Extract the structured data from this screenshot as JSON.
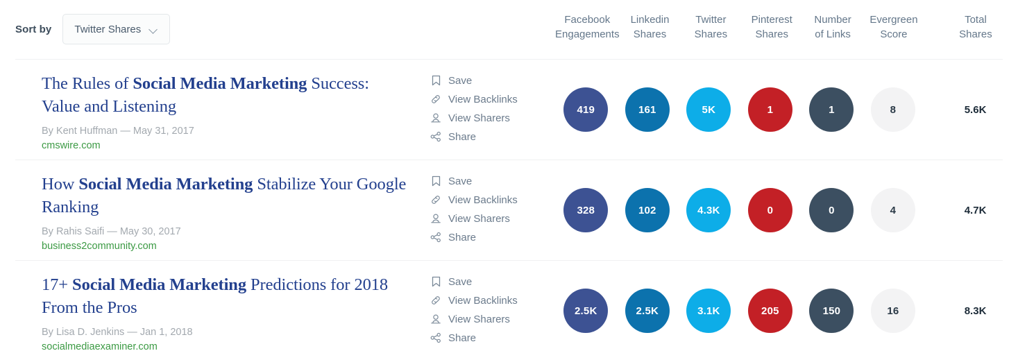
{
  "toolbar": {
    "sort_label": "Sort by",
    "sort_value": "Twitter Shares",
    "chevron_icon": "chevron-down-icon"
  },
  "columns": [
    {
      "line1": "Facebook",
      "line2": "Engagements",
      "sorted": false,
      "color": "#3d5293"
    },
    {
      "line1": "Linkedin",
      "line2": "Shares",
      "sorted": false,
      "color": "#0c72ad"
    },
    {
      "line1": "Twitter",
      "line2": "Shares",
      "sorted": true,
      "sort_arrow": "↓",
      "color": "#0dade8"
    },
    {
      "line1": "Pinterest",
      "line2": "Shares",
      "sorted": false,
      "color": "#c32026"
    },
    {
      "line1": "Number",
      "line2": "of Links",
      "sorted": false,
      "color": "#3c4f61"
    },
    {
      "line1": "Evergreen",
      "line2": "Score",
      "sorted": false,
      "color": "#f3f3f4"
    }
  ],
  "total_column": {
    "line1": "Total",
    "line2": "Shares"
  },
  "actions": [
    {
      "label": "Save",
      "icon": "bookmark-icon"
    },
    {
      "label": "View Backlinks",
      "icon": "link-icon"
    },
    {
      "label": "View Sharers",
      "icon": "person-icon"
    },
    {
      "label": "Share",
      "icon": "share-nodes-icon"
    }
  ],
  "rows": [
    {
      "title_parts": [
        {
          "text": "The Rules of ",
          "bold": false
        },
        {
          "text": "Social Media Marketing",
          "bold": true
        },
        {
          "text": " Success: Value and Listening",
          "bold": false
        }
      ],
      "byline": "By Kent Huffman — May 31, 2017",
      "domain": "cmswire.com",
      "metrics": [
        "419",
        "161",
        "5K",
        "1",
        "1",
        "8"
      ],
      "total": "5.6K"
    },
    {
      "title_parts": [
        {
          "text": "How ",
          "bold": false
        },
        {
          "text": "Social Media Marketing",
          "bold": true
        },
        {
          "text": " Stabilize Your Google Ranking",
          "bold": false
        }
      ],
      "byline": "By Rahis Saifi — May 30, 2017",
      "domain": "business2community.com",
      "metrics": [
        "328",
        "102",
        "4.3K",
        "0",
        "0",
        "4"
      ],
      "total": "4.7K"
    },
    {
      "title_parts": [
        {
          "text": "17+ ",
          "bold": false
        },
        {
          "text": "Social Media Marketing",
          "bold": true
        },
        {
          "text": " Predictions for 2018 From the Pros",
          "bold": false
        }
      ],
      "byline": "By Lisa D. Jenkins — Jan 1, 2018",
      "domain": "socialmediaexaminer.com",
      "metrics": [
        "2.5K",
        "2.5K",
        "3.1K",
        "205",
        "150",
        "16"
      ],
      "total": "8.3K"
    }
  ]
}
